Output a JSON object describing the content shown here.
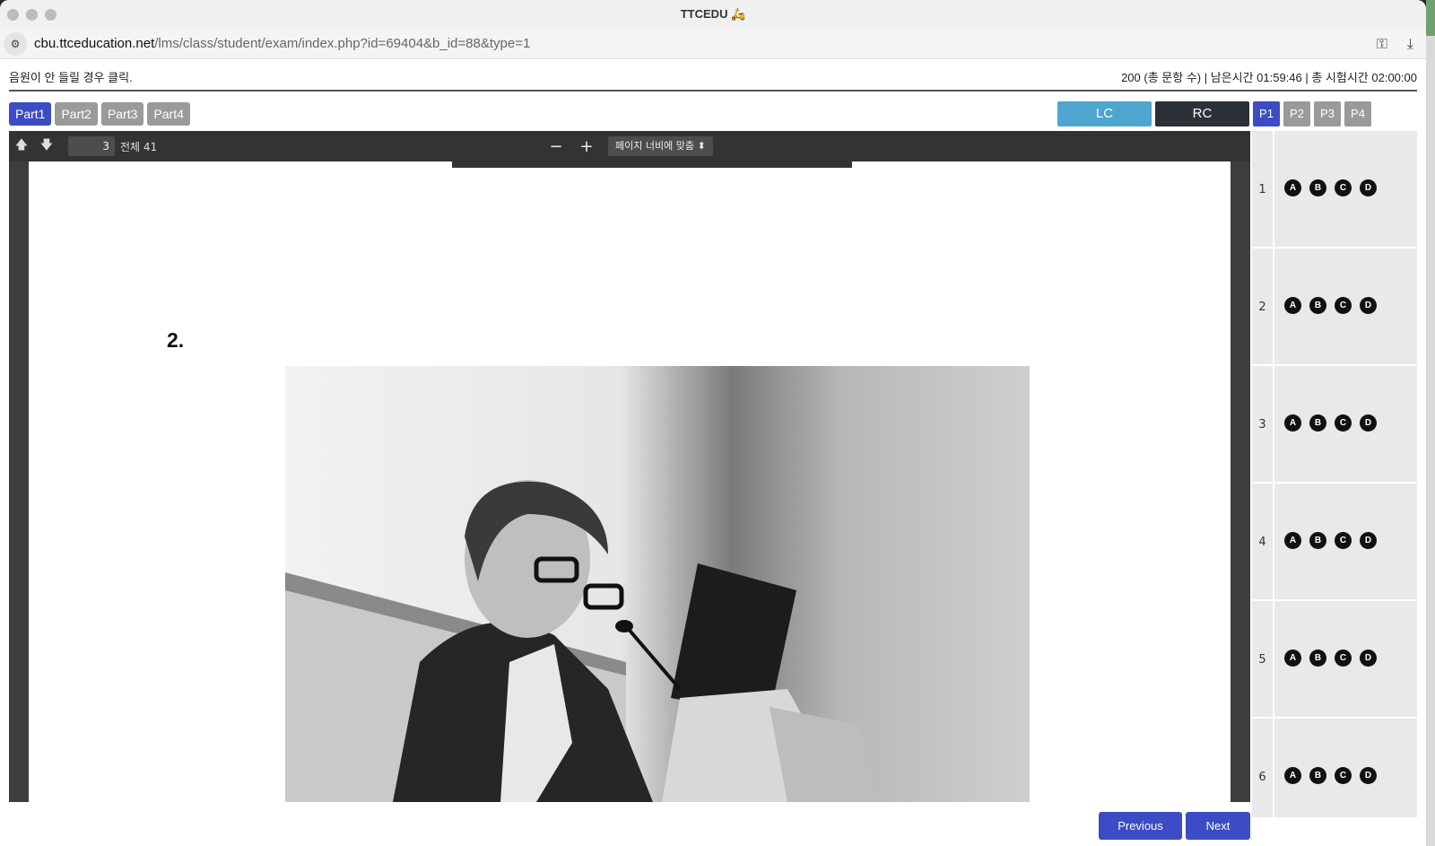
{
  "window": {
    "title": "TTCEDU 🛵"
  },
  "address": {
    "host": "cbu.ttceducation.net",
    "path": "/lms/class/student/exam/index.php?id=69404&b_id=88&type=1"
  },
  "info": {
    "audio_help": "음원이 안 들릴 경우 클릭.",
    "status": "200 (총 문항 수) | 남은시간 01:59:46 | 총 시험시간 02:00:00"
  },
  "parts": [
    "Part1",
    "Part2",
    "Part3",
    "Part4"
  ],
  "sections": {
    "lc": "LC",
    "rc": "RC"
  },
  "pages": [
    "P1",
    "P2",
    "P3",
    "P4"
  ],
  "viewer": {
    "page_number": "3",
    "page_total": "전체 41",
    "zoom_label": "페이지 너비에 맞춤",
    "question_label": "2."
  },
  "answer_sheet": {
    "questions": [
      "1",
      "2",
      "3",
      "4",
      "5",
      "6"
    ],
    "options": [
      "A",
      "B",
      "C",
      "D"
    ]
  },
  "buttons": {
    "previous": "Previous",
    "next": "Next"
  }
}
